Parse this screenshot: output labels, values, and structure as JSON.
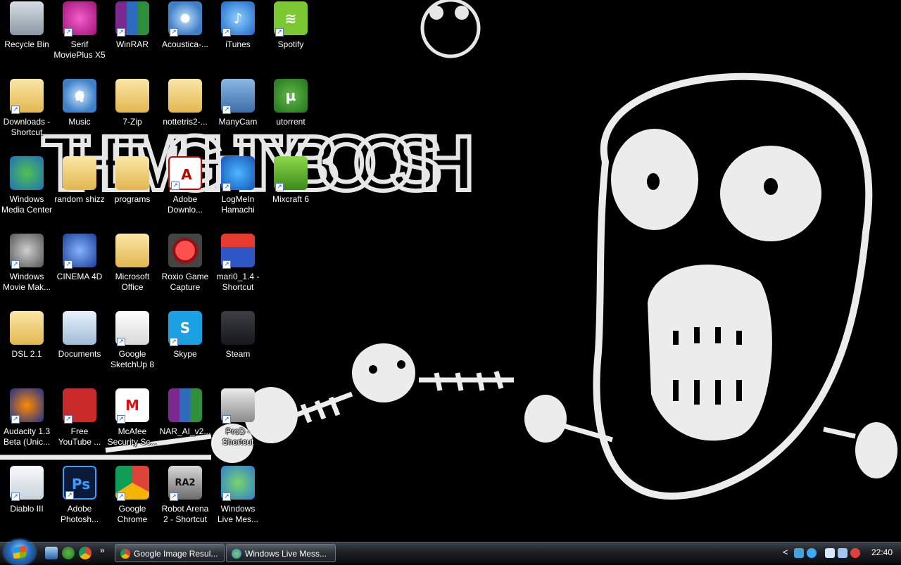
{
  "desktop": {
    "icons": [
      {
        "label": "Recycle Bin",
        "icon": "recycle-bin-icon",
        "glyph": "",
        "shortcut": false
      },
      {
        "label": "Serif\nMoviePlus X5",
        "icon": "movieplus-icon",
        "glyph": "",
        "shortcut": true
      },
      {
        "label": "WinRAR",
        "icon": "winrar-icon",
        "glyph": "",
        "shortcut": true
      },
      {
        "label": "Acoustica-...",
        "icon": "acoustica-icon",
        "glyph": "",
        "shortcut": true
      },
      {
        "label": "iTunes",
        "icon": "itunes-icon",
        "glyph": "♪",
        "shortcut": true
      },
      {
        "label": "Spotify",
        "icon": "spotify-icon",
        "glyph": "≋",
        "shortcut": true
      },
      {
        "label": "Downloads -\nShortcut",
        "icon": "folder-icon",
        "glyph": "",
        "shortcut": true
      },
      {
        "label": "Music",
        "icon": "music-icon",
        "glyph": "♫",
        "shortcut": false
      },
      {
        "label": "7-Zip",
        "icon": "folder-icon",
        "glyph": "",
        "shortcut": false
      },
      {
        "label": "nottetris2-...",
        "icon": "folder-icon",
        "glyph": "",
        "shortcut": false
      },
      {
        "label": "ManyCam",
        "icon": "manycam-icon",
        "glyph": "",
        "shortcut": true
      },
      {
        "label": "utorrent",
        "icon": "utorrent-icon",
        "glyph": "µ",
        "shortcut": false
      },
      {
        "label": "Windows\nMedia Center",
        "icon": "media-center-icon",
        "glyph": "",
        "shortcut": false
      },
      {
        "label": "random shizz",
        "icon": "folder-icon",
        "glyph": "",
        "shortcut": false
      },
      {
        "label": "programs",
        "icon": "folder-icon",
        "glyph": "",
        "shortcut": false
      },
      {
        "label": "Adobe\nDownlo...",
        "icon": "adobe-icon",
        "glyph": "A",
        "shortcut": true
      },
      {
        "label": "LogMeIn\nHamachi",
        "icon": "hamachi-icon",
        "glyph": "",
        "shortcut": true
      },
      {
        "label": "Mixcraft 6",
        "icon": "mixcraft-icon",
        "glyph": "",
        "shortcut": true
      },
      {
        "label": "Windows\nMovie Mak...",
        "icon": "movie-maker-icon",
        "glyph": "",
        "shortcut": true
      },
      {
        "label": "CINEMA 4D",
        "icon": "cinema4d-icon",
        "glyph": "",
        "shortcut": true
      },
      {
        "label": "Microsoft\nOffice",
        "icon": "office-folder-icon",
        "glyph": "",
        "shortcut": false
      },
      {
        "label": "Roxio Game\nCapture",
        "icon": "roxio-icon",
        "glyph": "",
        "shortcut": false
      },
      {
        "label": "mari0_1.4 -\nShortcut",
        "icon": "mario-icon",
        "glyph": "",
        "shortcut": true
      },
      {
        "label": "DSL 2.1",
        "icon": "folder-icon",
        "glyph": "",
        "shortcut": false
      },
      {
        "label": "Documents",
        "icon": "documents-icon",
        "glyph": "",
        "shortcut": false
      },
      {
        "label": "Google\nSketchUp 8",
        "icon": "sketchup-icon",
        "glyph": "",
        "shortcut": true
      },
      {
        "label": "Skype",
        "icon": "skype-icon",
        "glyph": "S",
        "shortcut": true
      },
      {
        "label": "Steam",
        "icon": "steam-icon",
        "glyph": "",
        "shortcut": false
      },
      {
        "label": "Audacity 1.3\nBeta (Unic...",
        "icon": "audacity-icon",
        "glyph": "",
        "shortcut": true
      },
      {
        "label": "Free\nYouTube ...",
        "icon": "youtube-converter-icon",
        "glyph": "",
        "shortcut": true
      },
      {
        "label": "McAfee\nSecurity Sc...",
        "icon": "mcafee-icon",
        "glyph": "M",
        "shortcut": true
      },
      {
        "label": "NAR_AI_v2...",
        "icon": "winrar-archive-icon",
        "glyph": "",
        "shortcut": false
      },
      {
        "label": "ProD -\nShortcut",
        "icon": "prod-icon",
        "glyph": "",
        "shortcut": true
      },
      {
        "label": "Diablo III",
        "icon": "diablo-icon",
        "glyph": "",
        "shortcut": true
      },
      {
        "label": "Adobe\nPhotosh...",
        "icon": "photoshop-icon",
        "glyph": "Ps",
        "shortcut": true
      },
      {
        "label": "Google\nChrome",
        "icon": "chrome-icon",
        "glyph": "",
        "shortcut": true
      },
      {
        "label": "Robot Arena\n2 - Shortcut",
        "icon": "robot-arena-icon",
        "glyph": "RA2",
        "shortcut": true
      },
      {
        "label": "Windows\nLive Mes...",
        "icon": "live-messenger-icon",
        "glyph": "",
        "shortcut": true
      }
    ]
  },
  "wallpaper": {
    "text": "THE MIGHTY BOOSH"
  },
  "taskbar": {
    "start_icon": "windows-start-orb-icon",
    "quick_launch": [
      "show-desktop-icon",
      "utorrent-icon",
      "chrome-icon"
    ],
    "more": "»",
    "buttons": [
      {
        "label": "Google Image Resul...",
        "icon": "chrome-icon"
      },
      {
        "label": "Windows Live Mess...",
        "icon": "live-messenger-icon"
      }
    ],
    "tray_arrow": "<",
    "clock": "22:40"
  }
}
